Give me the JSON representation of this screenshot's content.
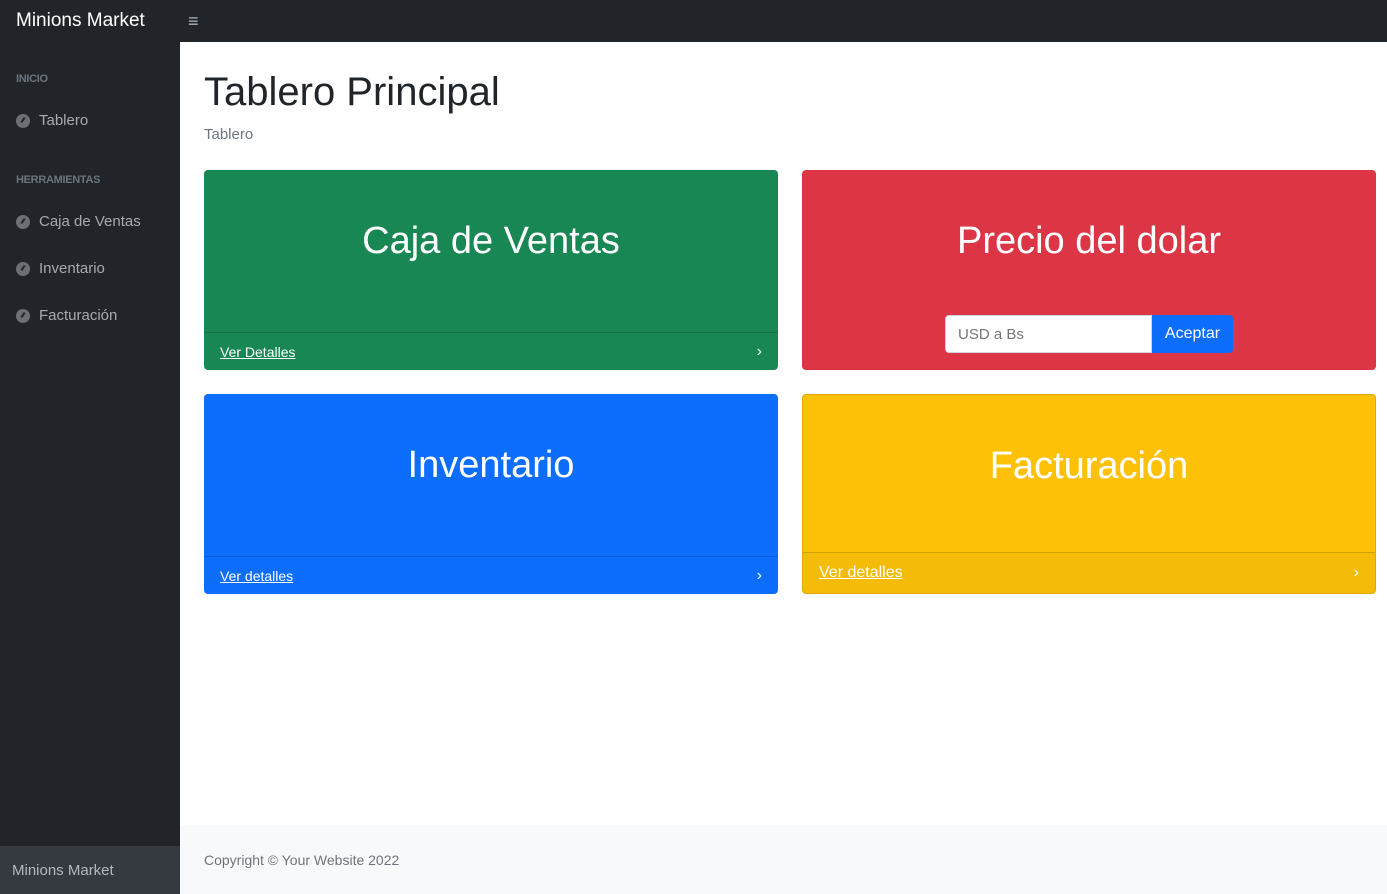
{
  "nav": {
    "brand": "Minions Market",
    "toggle": "≡"
  },
  "sidebar": {
    "sections": [
      {
        "heading": "INICIO",
        "items": [
          "Tablero"
        ]
      },
      {
        "heading": "HERRAMIENTAS",
        "items": [
          "Caja de Ventas",
          "Inventario",
          "Facturación"
        ]
      }
    ],
    "footer": "Minions Market"
  },
  "main": {
    "title": "Tablero Principal",
    "breadcrumb": "Tablero",
    "cards": [
      {
        "title": "Caja de Ventas",
        "link": "Ver Detalles",
        "color": "#198754"
      },
      {
        "title": "Precio del dolar",
        "placeholder": "USD a Bs",
        "button": "Aceptar",
        "color": "#dc3545"
      },
      {
        "title": "Inventario",
        "link": "Ver detalles",
        "color": "#0d6efd"
      },
      {
        "title": "Facturación",
        "link": "Ver detalles",
        "color": "#ffc107"
      }
    ],
    "footer": "Copyright © Your Website 2022"
  }
}
